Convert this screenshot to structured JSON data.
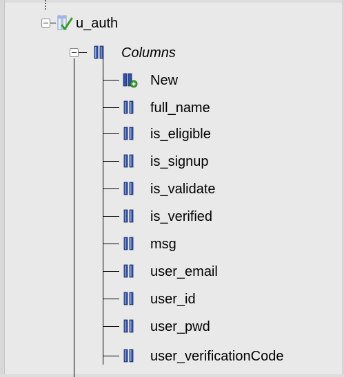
{
  "tree": {
    "table": {
      "label": "u_auth",
      "icon": "table-structure-icon"
    },
    "columns_group": {
      "label": "Columns",
      "icon": "columns-icon"
    },
    "new_item": {
      "label": "New",
      "icon": "add-column-icon"
    },
    "columns": [
      {
        "label": "full_name"
      },
      {
        "label": "is_eligible"
      },
      {
        "label": "is_signup"
      },
      {
        "label": "is_validate"
      },
      {
        "label": "is_verified"
      },
      {
        "label": "msg"
      },
      {
        "label": "user_email"
      },
      {
        "label": "user_id"
      },
      {
        "label": "user_pwd"
      },
      {
        "label": "user_verificationCode"
      }
    ]
  },
  "colors": {
    "background": "#e9e9e9",
    "tree_line": "#000000",
    "column_icon": "#2b4fa6"
  }
}
